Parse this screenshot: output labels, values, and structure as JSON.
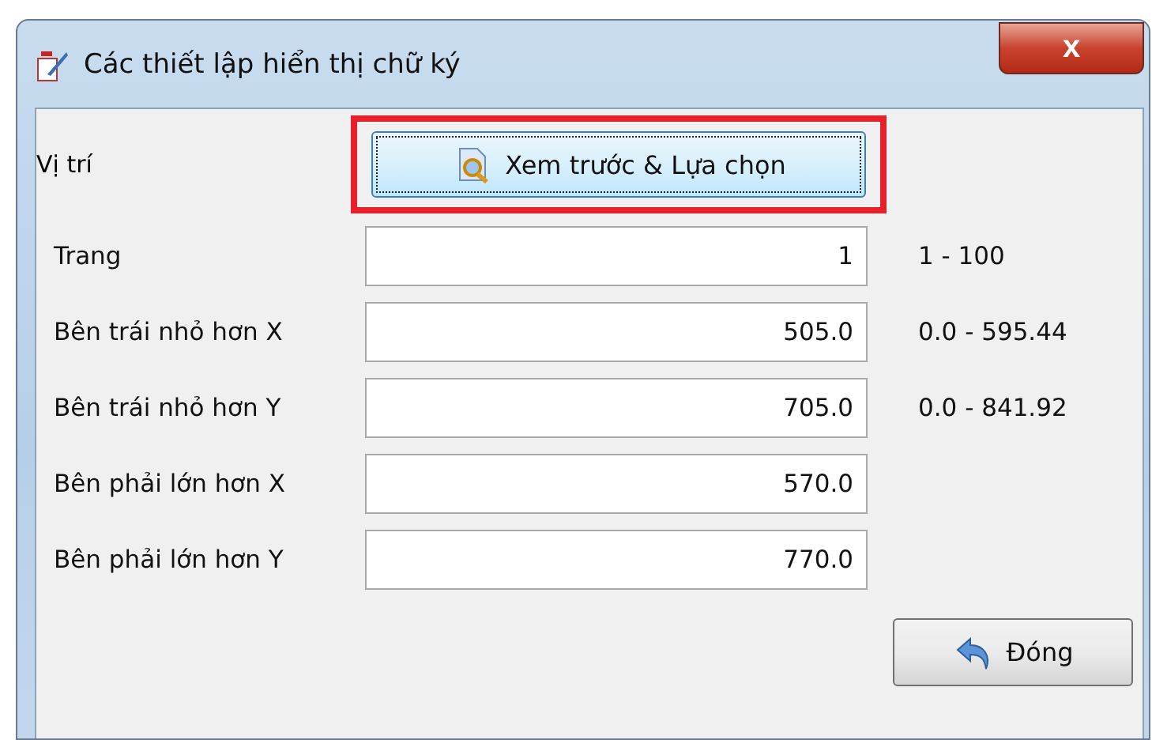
{
  "window": {
    "title": "Các thiết lập hiển thị chữ ký",
    "close": "x"
  },
  "position": {
    "label": "Vị trí",
    "button": "Xem trước & Lựa chọn",
    "highlighted": true
  },
  "fields": [
    {
      "label": "Trang",
      "value": "1",
      "range": "1 - 100"
    },
    {
      "label": "Bên trái nhỏ hơn X",
      "value": "505.0",
      "range": "0.0 - 595.44"
    },
    {
      "label": "Bên trái nhỏ hơn Y",
      "value": "705.0",
      "range": "0.0 - 841.92"
    },
    {
      "label": "Bên phải lớn hơn X",
      "value": "570.0"
    },
    {
      "label": "Bên phải lớn hơn Y",
      "value": "770.0"
    }
  ],
  "close_button": "Đóng"
}
